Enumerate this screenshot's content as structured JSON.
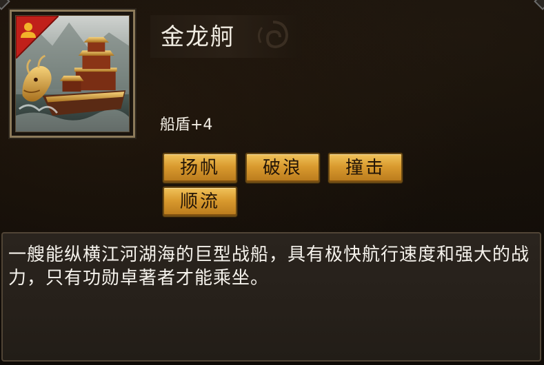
{
  "item": {
    "name": "金龙舸",
    "stat": "船盾+4",
    "description": "一艘能纵横江河湖海的巨型战船，具有极快航行速度和强大的战力，只有功勋卓著者才能乘坐。"
  },
  "skills": [
    "扬帆",
    "破浪",
    "撞击",
    "顺流"
  ],
  "icons": {
    "badge": "person-icon",
    "art": "golden-dragon-ship",
    "ornament": "cloud-swirl-ornament"
  },
  "colors": {
    "badge_red": "#c0201a",
    "button_gold": "#e0a53a",
    "text_light": "#f3efe6",
    "frame": "#8c7a5a"
  }
}
